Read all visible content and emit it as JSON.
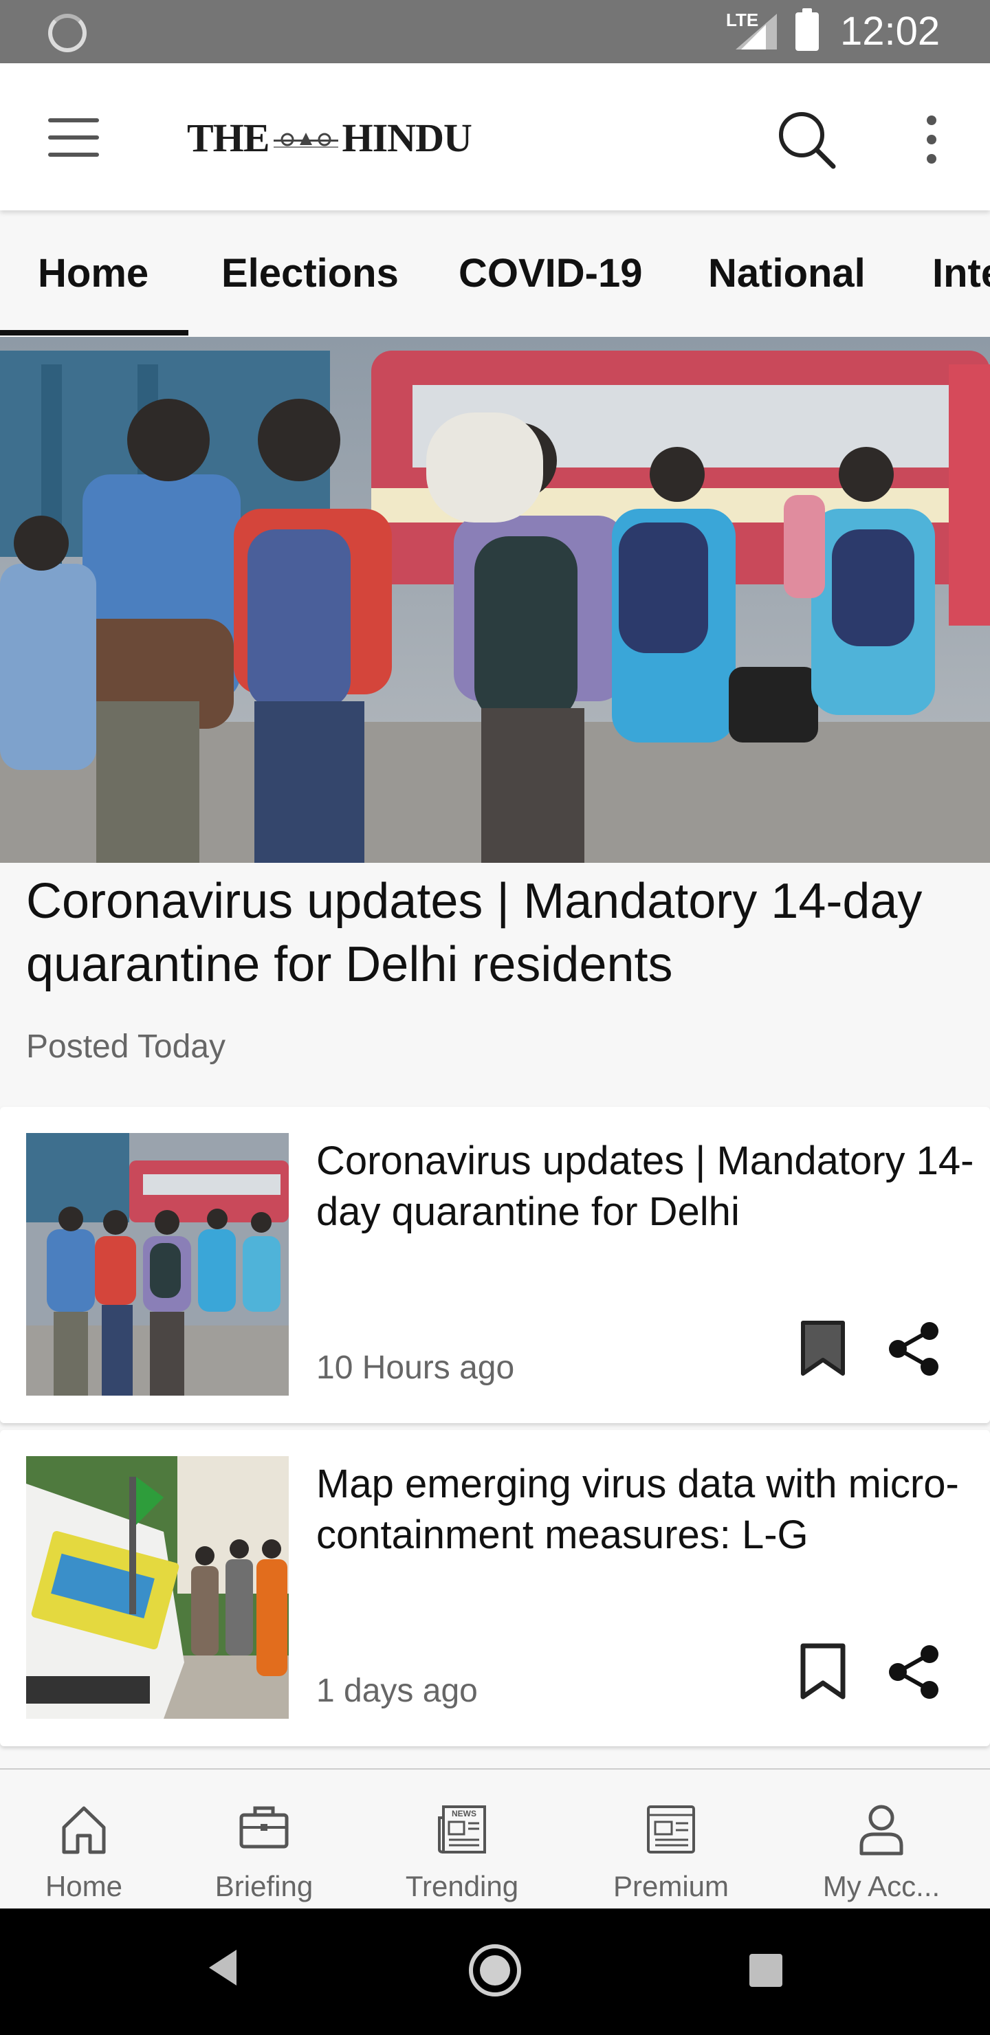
{
  "status_bar": {
    "network": "LTE",
    "time": "12:02"
  },
  "app_bar": {
    "logo_left": "THE",
    "logo_right": "HINDU"
  },
  "tabs": [
    {
      "label": "Home",
      "selected": true
    },
    {
      "label": "Elections",
      "selected": false
    },
    {
      "label": "COVID-19",
      "selected": false
    },
    {
      "label": "National",
      "selected": false
    },
    {
      "label": "Inte",
      "selected": false
    }
  ],
  "hero": {
    "title": "Coronavirus updates | Mandatory 14-day quarantine for Delhi residents",
    "meta": "Posted Today"
  },
  "articles": [
    {
      "title": "Coronavirus updates | Mandatory 14-day quarantine for Delhi",
      "time": "10 Hours ago",
      "bookmarked": true
    },
    {
      "title": "Map emerging virus data with micro-containment measures: L-G",
      "time": "1 days ago",
      "bookmarked": false
    }
  ],
  "bottom_nav": [
    {
      "label": "Home",
      "icon": "home-icon"
    },
    {
      "label": "Briefing",
      "icon": "briefcase-icon"
    },
    {
      "label": "Trending",
      "icon": "news-icon"
    },
    {
      "label": "Premium",
      "icon": "premium-news-icon"
    },
    {
      "label": "My Acc...",
      "icon": "account-icon"
    }
  ],
  "colors": {
    "status_bar": "#757575",
    "text_primary": "#111111",
    "text_secondary": "#666666",
    "nav_icon": "#555555"
  }
}
